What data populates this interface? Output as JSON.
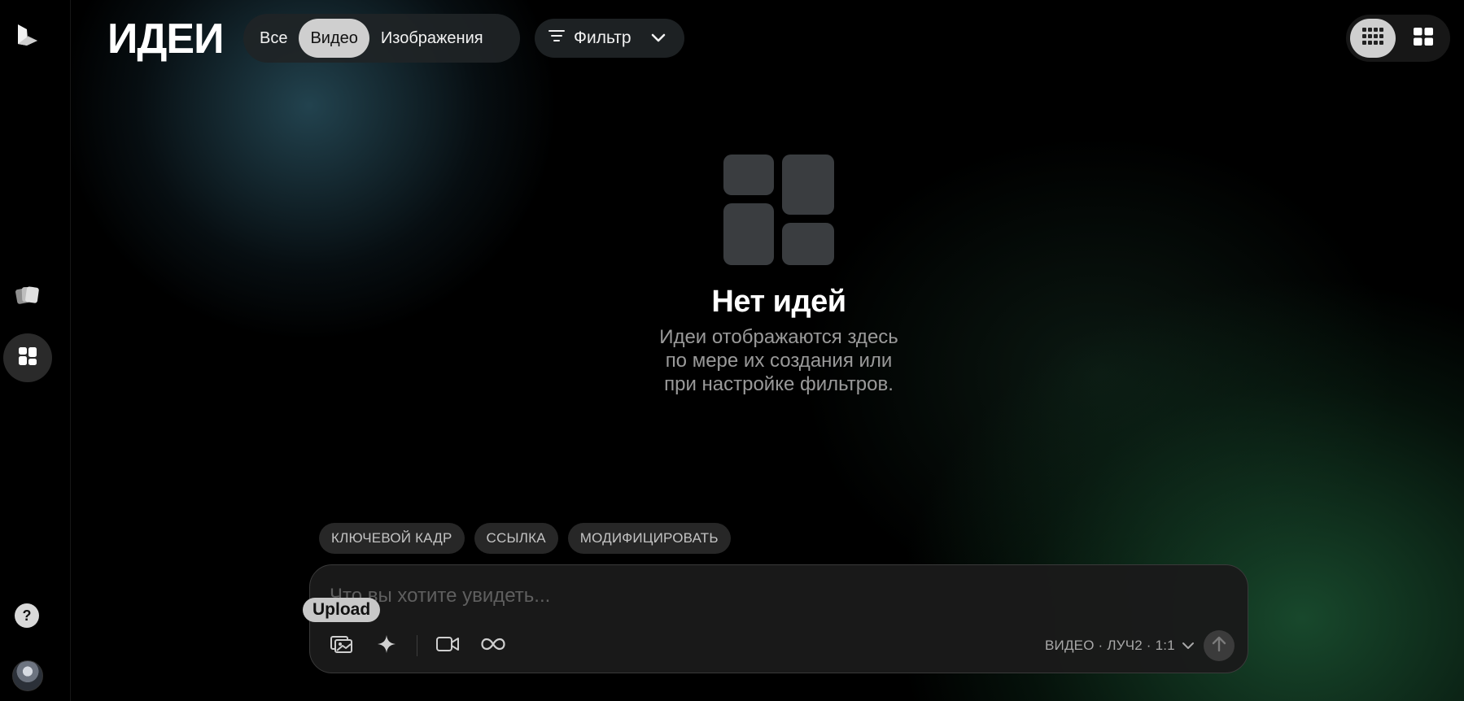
{
  "app": {
    "title": "ИДЕИ"
  },
  "sidebar": {
    "logo": "luma-logo-icon",
    "items": [
      {
        "icon": "cards-icon",
        "active": false
      },
      {
        "icon": "grid-icon",
        "active": true
      }
    ],
    "help_label": "?",
    "avatar": "user-avatar"
  },
  "header": {
    "tabs": [
      {
        "label": "Все",
        "active": false
      },
      {
        "label": "Видео",
        "active": true
      },
      {
        "label": "Изображения",
        "active": false
      }
    ],
    "filter": {
      "label": "Фильтр",
      "icon": "filter-lines-icon",
      "chevron": "chevron-down-icon"
    },
    "view_modes": [
      {
        "icon": "dense-grid-icon",
        "active": true
      },
      {
        "icon": "large-grid-icon",
        "active": false
      }
    ]
  },
  "empty_state": {
    "icon": "placeholder-tiles-icon",
    "title": "Нет идей",
    "lines": [
      "Идеи отображаются здесь",
      "по мере их создания или",
      "при настройке фильтров."
    ]
  },
  "chips": [
    {
      "label": "КЛЮЧЕВОЙ КАДР"
    },
    {
      "label": "ССЫЛКА"
    },
    {
      "label": "МОДИФИЦИРОВАТЬ"
    }
  ],
  "prompt": {
    "placeholder": "Что вы хотите увидеть...",
    "value": "",
    "tooltip": "Upload",
    "tools": [
      {
        "icon": "image-upload-icon"
      },
      {
        "icon": "sparkle-icon"
      },
      {
        "icon": "video-camera-icon"
      },
      {
        "icon": "infinity-icon"
      }
    ],
    "settings_label": "ВИДЕО · ЛУЧ2 · 1:1",
    "settings_chevron": "chevron-down-icon",
    "send_icon": "arrow-up-icon"
  },
  "colors": {
    "background": "#000000",
    "active_pill": "#cfcfcf",
    "pill_bg": "#202426",
    "muted_text": "#9a9a9a",
    "accent_green": "#1e5a37",
    "accent_teal": "#284e5c"
  }
}
